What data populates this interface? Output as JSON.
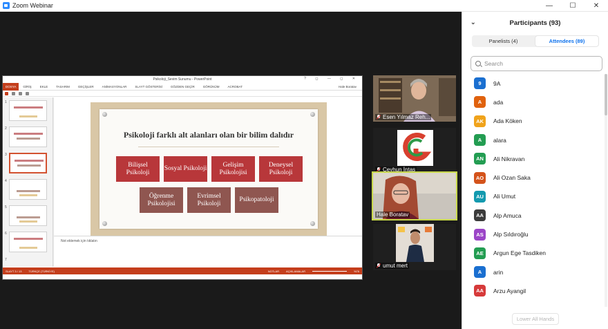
{
  "window": {
    "title": "Zoom Webinar",
    "minimize": "—",
    "maximize": "☐",
    "close": "✕"
  },
  "ppt": {
    "title": "Psikoloji_Sevim Sunumu - PowerPoint",
    "title_controls": "? ◻ — ◻ ✕",
    "file_tab": "DOSYA",
    "ribbon_tabs": [
      "GİRİŞ",
      "EKLE",
      "TASARIM",
      "GEÇİŞLER",
      "ANİMASYONLAR",
      "SLAYT GÖSTERİSİ",
      "GÖZDEN GEÇİR",
      "GÖRÜNÜM",
      "ACROBAT"
    ],
    "user": "Hale Boratav",
    "thumbnail_numbers": [
      "1",
      "2",
      "3",
      "4",
      "5",
      "6",
      "7"
    ],
    "slide": {
      "title": "Psikoloji farklı alt alanları olan bir bilim dalıdır",
      "row1": [
        "Bilişsel Psikoloji",
        "Sosyal Psikoloji",
        "Gelişim Psikolojisi",
        "Deneysel Psikoloji"
      ],
      "row2": [
        "Öğrenme Psikolojisi",
        "Evrimsel Psikoloji",
        "Psikopatoloji"
      ]
    },
    "notes_placeholder": "Not eklemek için tıklatın",
    "status": {
      "slide_info": "SLAYT 3 / 13",
      "language": "TÜRKÇE (TÜRKİYE)",
      "notes": "NOTLAR",
      "comments": "AÇIKLAMALAR",
      "zoom": "%76"
    },
    "colors": {
      "accent": "#c43e1c",
      "box_red": "#b8373a",
      "box_brown": "#8f5650"
    }
  },
  "tiles": [
    {
      "name": "Esen Yılmaz Reh..."
    },
    {
      "name": "Ceyhun İntaş"
    },
    {
      "name": "Hale Boratav"
    },
    {
      "name": "umut mert"
    }
  ],
  "panel": {
    "title": "Participants (93)",
    "tabs": [
      "Panelists (4)",
      "Attendees (89)"
    ],
    "search_placeholder": "Search",
    "participants": [
      {
        "initials": "9",
        "name": "9A",
        "color": "#1a6fd0"
      },
      {
        "initials": "A",
        "name": "ada",
        "color": "#e0620e"
      },
      {
        "initials": "AK",
        "name": "Ada Köken",
        "color": "#f0a31b"
      },
      {
        "initials": "A",
        "name": "alara",
        "color": "#239d52"
      },
      {
        "initials": "AN",
        "name": "Ali Nikravan",
        "color": "#239d52"
      },
      {
        "initials": "AO",
        "name": "Ali Ozan Saka",
        "color": "#d4531b"
      },
      {
        "initials": "AU",
        "name": "Ali Umut",
        "color": "#139aaf"
      },
      {
        "initials": "AA",
        "name": "Alp Amuca",
        "color": "#3c3c3c"
      },
      {
        "initials": "AS",
        "name": "Alp Sıldıroğlu",
        "color": "#9b45c7"
      },
      {
        "initials": "AE",
        "name": "Argun Ege Tasdiken",
        "color": "#239d52"
      },
      {
        "initials": "A",
        "name": "arin",
        "color": "#1a6fd0"
      },
      {
        "initials": "AA",
        "name": "Arzu Ayangil",
        "color": "#d63a3a"
      }
    ],
    "lower_all_hands": "Lower All Hands"
  }
}
